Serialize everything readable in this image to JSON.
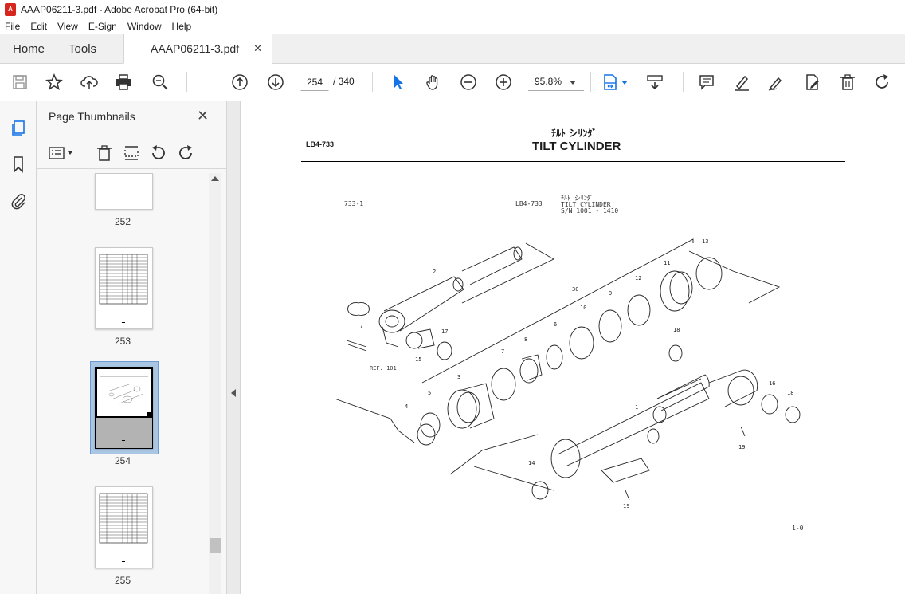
{
  "window": {
    "title": "AAAP06211-3.pdf - Adobe Acrobat Pro (64-bit)"
  },
  "menu": [
    "File",
    "Edit",
    "View",
    "E-Sign",
    "Window",
    "Help"
  ],
  "tabs": {
    "home": "Home",
    "tools": "Tools",
    "document": "AAAP06211-3.pdf",
    "close": "✕"
  },
  "toolbar": {
    "page_current": "254",
    "page_total": "/  340",
    "zoom": "95.8%"
  },
  "panel": {
    "title": "Page Thumbnails",
    "thumbnails": [
      {
        "label": "252"
      },
      {
        "label": "253"
      },
      {
        "label": "254"
      },
      {
        "label": "255"
      }
    ]
  },
  "document": {
    "header_jp": "ﾁﾙﾄ シﾘﾝﾀﾞ",
    "header_title": "TILT CYLINDER",
    "header_code": "LB4-733",
    "figure_code": "733-1",
    "figure_ref": "LB4-733",
    "figure_jp": "ﾁﾙﾄ シﾘﾝﾀﾞ",
    "figure_title": "TILT CYLINDER",
    "figure_sn": "S/N 1001 - 1410",
    "figure_page": "1-0",
    "ref_label": "REF. 101",
    "callouts": [
      "1",
      "2",
      "3",
      "4",
      "5",
      "6",
      "7",
      "8",
      "9",
      "10",
      "11",
      "12",
      "13",
      "14",
      "15",
      "16",
      "17",
      "17",
      "18",
      "18",
      "19",
      "19",
      "30"
    ]
  }
}
